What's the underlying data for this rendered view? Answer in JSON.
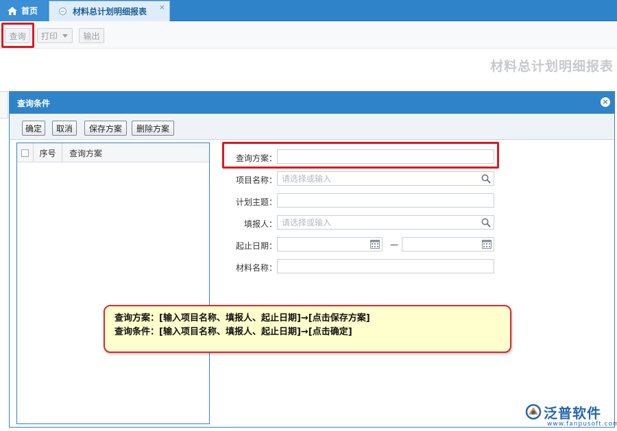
{
  "tabs": {
    "home_label": "首页",
    "active_label": "材料总计划明细报表",
    "close_glyph": "×"
  },
  "toolbar": {
    "query_label": "查询",
    "print_label": "打印",
    "export_label": "输出"
  },
  "report_title": "材料总计划明细报表",
  "dialog": {
    "title": "查询条件",
    "close_glyph": "×",
    "buttons": {
      "ok": "确定",
      "cancel": "取消",
      "save_plan": "保存方案",
      "delete_plan": "删除方案"
    },
    "plan_list": {
      "col_no": "序号",
      "col_plan": "查询方案",
      "rows": []
    },
    "form": {
      "plan_label": "查询方案：",
      "plan_value": "",
      "project_label": "项目名称：",
      "project_placeholder": "请选择或输入",
      "theme_label": "计划主题：",
      "theme_value": "",
      "filler_label": "填报人：",
      "filler_placeholder": "请选择或输入",
      "date_label": "起止日期：",
      "date_start": "",
      "date_end": "",
      "date_separator": "—",
      "material_label": "材料名称：",
      "material_value": ""
    }
  },
  "note": {
    "line1": "查询方案：[输入项目名称、填报人、起止日期]→[点击保存方案]",
    "line2": "查询条件：[输入项目名称、填报人、起止日期]→[点击确定]"
  },
  "logo": {
    "name": "泛普软件",
    "url": "www.fanpusoft.com"
  },
  "colors": {
    "accent": "#2f83c9",
    "highlight": "#e0161d",
    "note_bg": "#fffecd",
    "logo": "#2666b0"
  },
  "icons": {
    "home": "home-icon",
    "tab": "page-icon",
    "search": "search-icon",
    "calendar": "calendar-icon",
    "print_dropdown": "chevron-down-icon"
  }
}
